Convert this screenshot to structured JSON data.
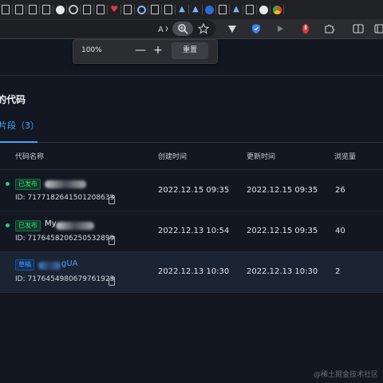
{
  "browser": {
    "tabs": [
      "page",
      "page",
      "page",
      "page",
      "github",
      "gear",
      "page",
      "page",
      "heart",
      "page",
      "search",
      "page",
      "page",
      "bird",
      "bird",
      "globe",
      "page",
      "bird",
      "page",
      "github",
      "chrome"
    ],
    "toolbar_icons": [
      "read-aloud-icon",
      "zoom-icon",
      "favorite-icon",
      "brave-icon",
      "shield-icon",
      "play-icon",
      "extension-red-icon",
      "puzzle-icon",
      "split-screen-icon",
      "favorites-bar-icon"
    ]
  },
  "zoom_popup": {
    "level": "100%",
    "minus": "—",
    "plus": "+",
    "reset": "重置"
  },
  "page": {
    "section_title": "的代码",
    "tab_label": "片段（3）",
    "columns": {
      "name": "代码名称",
      "created": "创建时间",
      "updated": "更新时间",
      "views": "浏览量"
    },
    "rows": [
      {
        "status": "已发布",
        "title_prefix": "",
        "title_suffix": "",
        "id": "ID: 7177182641501208633",
        "created": "2022.12.15 09:35",
        "updated": "2022.12.15 09:35",
        "views": "26"
      },
      {
        "status": "已发布",
        "title_prefix": "My",
        "title_suffix": "",
        "id": "ID: 7176458206250532899",
        "created": "2022.12.13 10:54",
        "updated": "2022.12.15 09:35",
        "views": "40"
      },
      {
        "status": "草稿",
        "title_prefix": "",
        "title_suffix": "gUA",
        "id": "ID: 7176454980679761923",
        "created": "2022.12.13 10:30",
        "updated": "2022.12.13 10:30",
        "views": "2"
      }
    ]
  },
  "watermark": "@稀土掘金技术社区",
  "colors": {
    "background": "#121722",
    "accent": "#3ea6ff",
    "published": "#40d07a",
    "draft": "#4f9cff"
  }
}
